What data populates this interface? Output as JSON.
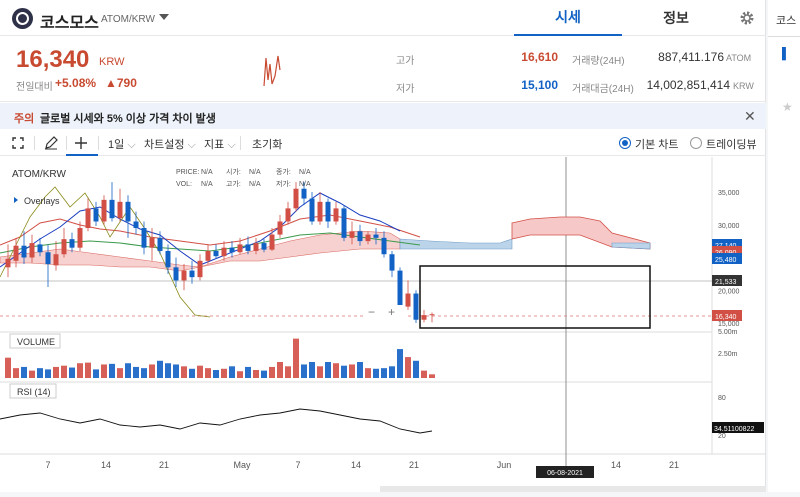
{
  "header": {
    "coin_name": "코스모스",
    "coin_pair": "ATOM/KRW",
    "tab_market": "시세",
    "tab_info": "정보"
  },
  "price": {
    "current": "16,340",
    "unit": "KRW",
    "change_label": "전일대비",
    "change_rate": "+5.08%",
    "change_amount": "▲790"
  },
  "stats": {
    "high_label": "고가",
    "high_value": "16,610",
    "low_label": "저가",
    "low_value": "15,100",
    "volume_label": "거래량(24H)",
    "volume_value": "887,411.176",
    "volume_unit": "ATOM",
    "amount_label": "거래대금(24H)",
    "amount_value": "14,002,851,414",
    "amount_unit": "KRW"
  },
  "notice": {
    "tag": "주의",
    "text": "글로벌 시세와 5% 이상 가격 차이 발생"
  },
  "toolbar": {
    "interval": "1일",
    "chart_settings": "차트설정",
    "indicators": "지표",
    "reset": "초기화",
    "basic_chart": "기본 차트",
    "trading_view": "트레이딩뷰"
  },
  "chart": {
    "symbol": "ATOM/KRW",
    "overlays": "Overlays",
    "ohlc": {
      "price_label": "PRICE:",
      "price_value": "N/A",
      "open_label": "시가:",
      "open_value": "N/A",
      "close_label": "종가:",
      "close_value": "N/A",
      "vol_label": "VOL:",
      "vol_value": "N/A",
      "high_label": "고가:",
      "high_value": "N/A",
      "low_label": "저가:",
      "low_value": "N/A"
    },
    "volume_label": "VOLUME",
    "rsi_label": "RSI (14)",
    "price_axis": [
      "35,000",
      "30,000",
      "25,000",
      "20,000",
      "15,000"
    ],
    "price_tags": [
      "27,140",
      "26,090",
      "25,480",
      "21,533",
      "16,340"
    ],
    "volume_axis": [
      "5.00m",
      "2.50m"
    ],
    "rsi_axis": [
      "80",
      "20"
    ],
    "rsi_tag": "34.51100822",
    "x_axis": [
      "7",
      "14",
      "21",
      "May",
      "7",
      "14",
      "21",
      "Jun",
      "14",
      "21"
    ],
    "crosshair_date": "06-08-2021",
    "colors": {
      "up": "#d24f45",
      "down": "#1261c4",
      "cloud_up": "#f6c8c8",
      "cloud_down": "#bcd4ea"
    }
  },
  "right_panel": {
    "tab": "코스"
  }
}
